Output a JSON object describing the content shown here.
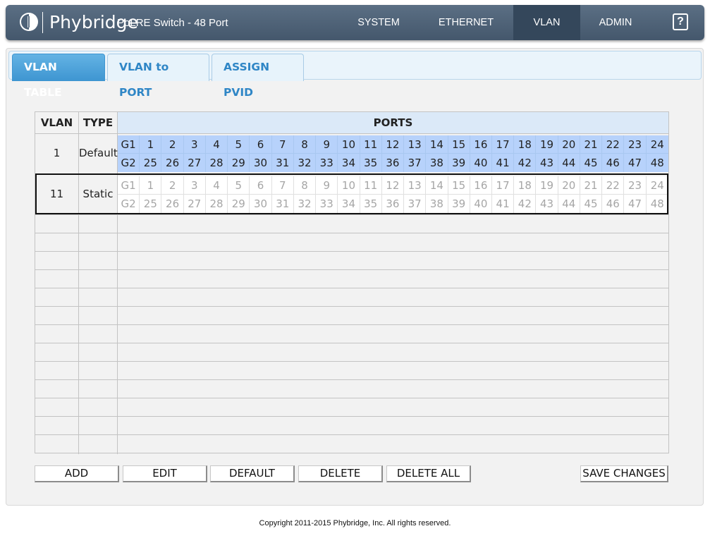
{
  "header": {
    "brand": "Phybridge",
    "product": "PoLRE Switch - 48 Port",
    "nav": [
      "SYSTEM",
      "ETHERNET",
      "VLAN",
      "ADMIN"
    ],
    "active_nav": "VLAN",
    "help_label": "?",
    "icons": {
      "logo": "phybridge-logo-icon",
      "help": "help-icon"
    },
    "colors": {
      "header_bg": "#4e6278",
      "active_nav_bg": "#34475b"
    }
  },
  "tabs": {
    "items": [
      "VLAN TABLE",
      "VLAN to PORT",
      "ASSIGN PVID"
    ],
    "active": "VLAN TABLE",
    "colors": {
      "active_bg": "#4aa0da",
      "inactive_text": "#2f86c6"
    }
  },
  "table": {
    "headers": {
      "vlan": "VLAN",
      "type": "TYPE",
      "ports": "PORTS"
    },
    "rows": [
      {
        "vlan": "1",
        "type": "Default",
        "port_rows": [
          [
            "G1",
            "1",
            "2",
            "3",
            "4",
            "5",
            "6",
            "7",
            "8",
            "9",
            "10",
            "11",
            "12",
            "13",
            "14",
            "15",
            "16",
            "17",
            "18",
            "19",
            "20",
            "21",
            "22",
            "23",
            "24"
          ],
          [
            "G2",
            "25",
            "26",
            "27",
            "28",
            "29",
            "30",
            "31",
            "32",
            "33",
            "34",
            "35",
            "36",
            "37",
            "38",
            "39",
            "40",
            "41",
            "42",
            "43",
            "44",
            "45",
            "46",
            "47",
            "48"
          ]
        ],
        "port_state": "member",
        "selected": false
      },
      {
        "vlan": "11",
        "type": "Static",
        "port_rows": [
          [
            "G1",
            "1",
            "2",
            "3",
            "4",
            "5",
            "6",
            "7",
            "8",
            "9",
            "10",
            "11",
            "12",
            "13",
            "14",
            "15",
            "16",
            "17",
            "18",
            "19",
            "20",
            "21",
            "22",
            "23",
            "24"
          ],
          [
            "G2",
            "25",
            "26",
            "27",
            "28",
            "29",
            "30",
            "31",
            "32",
            "33",
            "34",
            "35",
            "36",
            "37",
            "38",
            "39",
            "40",
            "41",
            "42",
            "43",
            "44",
            "45",
            "46",
            "47",
            "48"
          ]
        ],
        "port_state": "non-member",
        "selected": true
      }
    ],
    "colors": {
      "member_bg": "#b7d2fb",
      "non_member_text": "#a6a6a6",
      "ports_header_bg": "#dbe9f8"
    }
  },
  "buttons": {
    "add": "ADD",
    "edit": "EDIT",
    "default": "DEFAULT",
    "delete": "DELETE",
    "delete_all": "DELETE ALL",
    "save_changes": "SAVE CHANGES"
  },
  "footer": {
    "copyright": "Copyright 2011-2015 Phybridge, Inc. All rights reserved."
  }
}
